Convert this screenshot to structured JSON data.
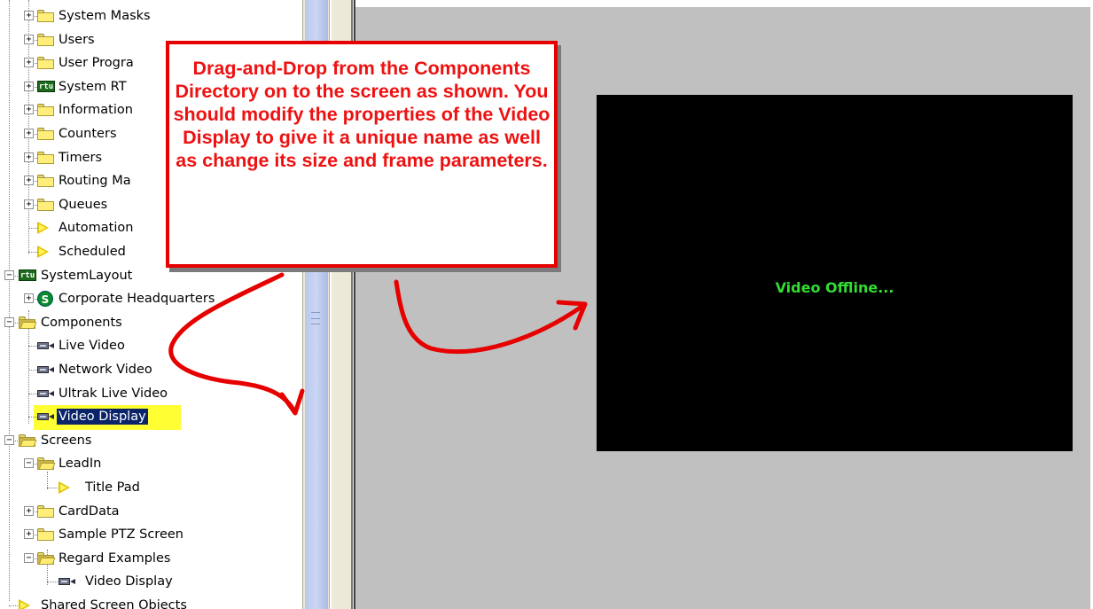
{
  "tree": {
    "items": [
      {
        "label": "System Masks",
        "icon": "folder-icon",
        "expander": "+"
      },
      {
        "label": "Users",
        "icon": "folder-icon",
        "expander": "+"
      },
      {
        "label": "User Progra",
        "icon": "folder-icon",
        "expander": "+"
      },
      {
        "label": "System RT",
        "icon": "rtu-icon",
        "expander": "+"
      },
      {
        "label": "Information",
        "icon": "folder-icon",
        "expander": "+"
      },
      {
        "label": "Counters",
        "icon": "folder-icon",
        "expander": "+"
      },
      {
        "label": "Timers",
        "icon": "folder-icon",
        "expander": "+"
      },
      {
        "label": "Routing Ma",
        "icon": "folder-icon",
        "expander": "+"
      },
      {
        "label": "Queues",
        "icon": "folder-icon",
        "expander": "+"
      },
      {
        "label": "Automation",
        "icon": "triangle-icon",
        "expander": ""
      },
      {
        "label": "Scheduled",
        "icon": "triangle-icon",
        "expander": ""
      },
      {
        "label": "SystemLayout",
        "icon": "rtu-icon",
        "expander": "−"
      },
      {
        "label": "Corporate Headquarters",
        "icon": "dollar-icon",
        "expander": "+"
      },
      {
        "label": "Components",
        "icon": "folder-open-icon",
        "expander": "−"
      },
      {
        "label": "Live Video",
        "icon": "camera-icon",
        "expander": ""
      },
      {
        "label": "Network Video",
        "icon": "camera-icon",
        "expander": ""
      },
      {
        "label": "Ultrak Live Video",
        "icon": "camera-icon",
        "expander": ""
      },
      {
        "label": "Video Display",
        "icon": "camera-icon",
        "expander": "",
        "selected": true
      },
      {
        "label": "Screens",
        "icon": "folder-open-icon",
        "expander": "−"
      },
      {
        "label": "LeadIn",
        "icon": "folder-open-icon",
        "expander": "−"
      },
      {
        "label": "Title Pad",
        "icon": "triangle-icon",
        "expander": ""
      },
      {
        "label": "CardData",
        "icon": "folder-icon",
        "expander": "+"
      },
      {
        "label": "Sample PTZ Screen",
        "icon": "folder-icon",
        "expander": "+"
      },
      {
        "label": "Regard Examples",
        "icon": "folder-open-icon",
        "expander": "−"
      },
      {
        "label": "Video Display",
        "icon": "camera-icon",
        "expander": ""
      },
      {
        "label": "Shared Screen Objects",
        "icon": "triangle-icon",
        "expander": ""
      }
    ]
  },
  "callout": {
    "text": "Drag-and-Drop from the Components Directory on to the screen as shown.  You should modify the properties of the Video Display to give it a unique name as well as change its size and frame parameters."
  },
  "video_display": {
    "status": "Video Offline..."
  },
  "colors": {
    "callout_border": "#e60000",
    "callout_text": "#ee1111",
    "video_status": "#33dd33",
    "surface": "#c0c0c0",
    "highlight": "#ffff33"
  },
  "icons": {
    "folder": "folder-icon",
    "folder_open": "folder-open-icon",
    "rtu": "rtu-icon",
    "dollar": "dollar-icon",
    "camera": "camera-icon",
    "triangle": "triangle-icon"
  },
  "rtu_glyph": "rtu",
  "dollar_glyph": "S"
}
